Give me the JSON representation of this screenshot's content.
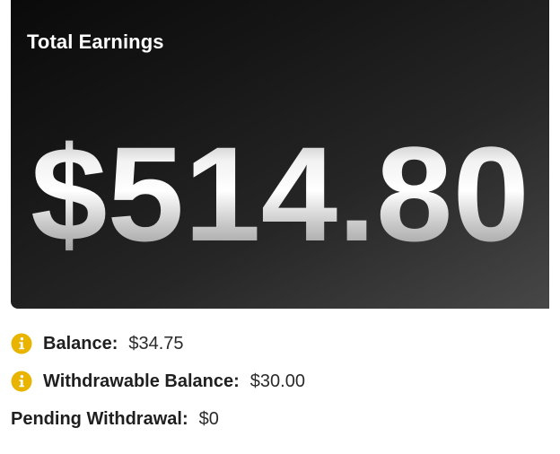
{
  "card": {
    "title": "Total Earnings",
    "amount": "$514.80"
  },
  "details": {
    "balance": {
      "label": "Balance:",
      "value": "$34.75",
      "icon": "info-icon"
    },
    "withdrawable": {
      "label": "Withdrawable Balance:",
      "value": "$30.00",
      "icon": "info-icon"
    },
    "pending": {
      "label": "Pending Withdrawal:",
      "value": "$0"
    }
  },
  "colors": {
    "card_dark": "#0a0a0a",
    "card_light": "#474747",
    "title_text": "#ffffff",
    "info_icon": "#e8b400",
    "body_text": "#222222"
  }
}
